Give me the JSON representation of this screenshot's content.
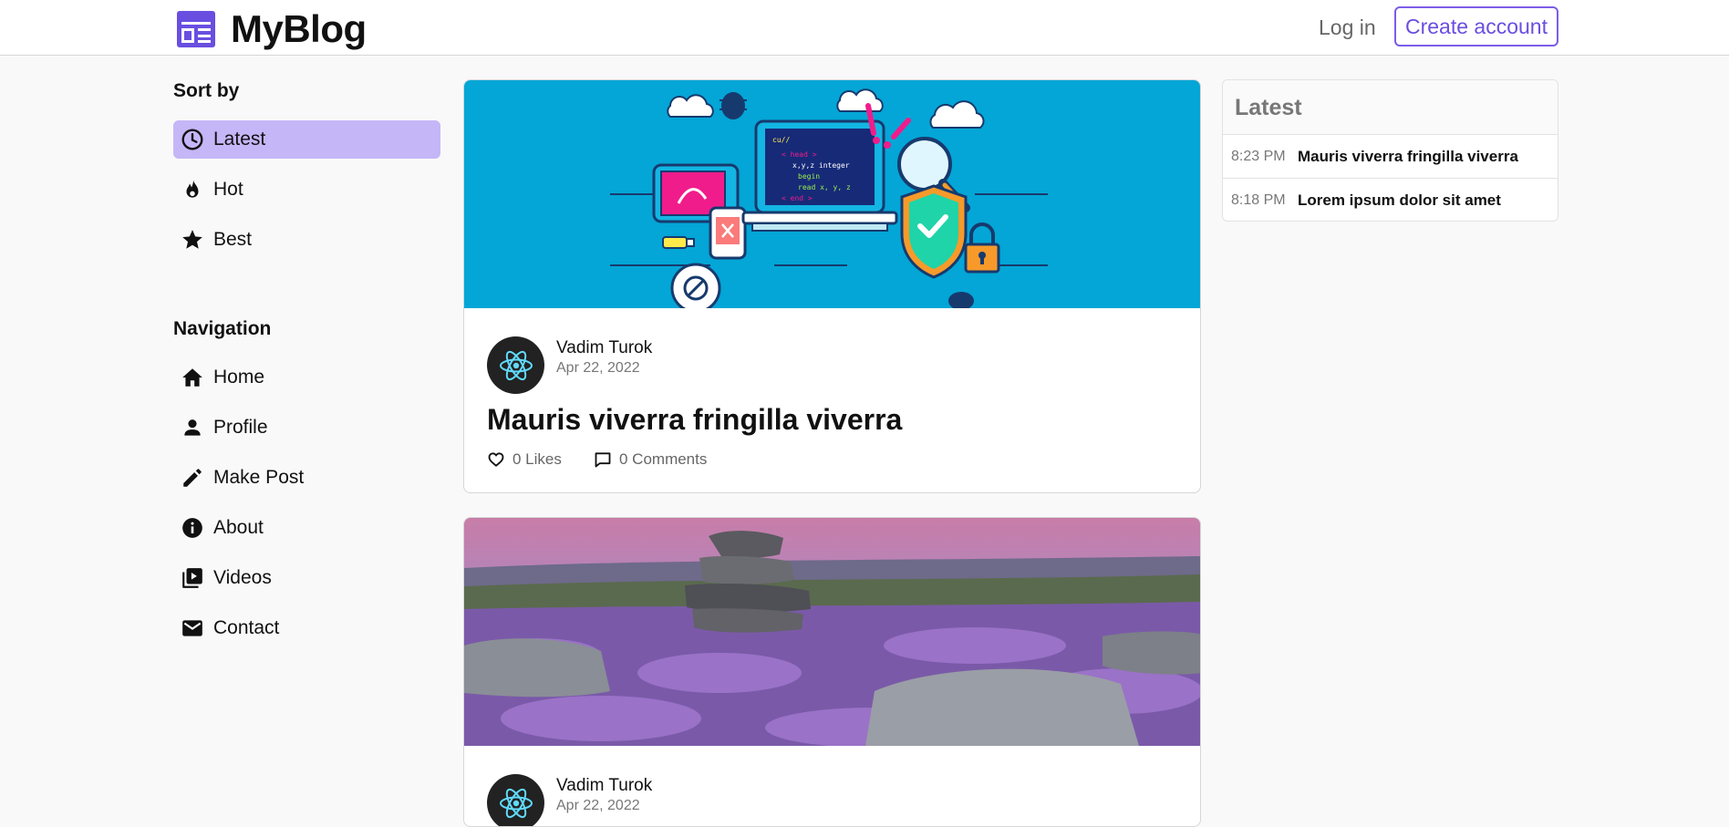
{
  "header": {
    "brand": "MyBlog",
    "login_label": "Log in",
    "create_label": "Create account"
  },
  "sidebar": {
    "sort_title": "Sort by",
    "sort_items": [
      {
        "label": "Latest",
        "icon": "clock-icon",
        "active": true
      },
      {
        "label": "Hot",
        "icon": "flame-icon"
      },
      {
        "label": "Best",
        "icon": "star-icon"
      }
    ],
    "nav_title": "Navigation",
    "nav_items": [
      {
        "label": "Home",
        "icon": "home-icon"
      },
      {
        "label": "Profile",
        "icon": "person-icon"
      },
      {
        "label": "Make Post",
        "icon": "pencil-icon"
      },
      {
        "label": "About",
        "icon": "info-icon"
      },
      {
        "label": "Videos",
        "icon": "video-library-icon"
      },
      {
        "label": "Contact",
        "icon": "mail-icon"
      }
    ]
  },
  "posts": [
    {
      "author": "Vadim Turok",
      "date": "Apr 22, 2022",
      "title": "Mauris viverra fringilla viverra",
      "likes": "0 Likes",
      "comments": "0 Comments",
      "cover_code": {
        "line1": "cu//",
        "line2": "< head >",
        "line3": "x,y,z integer",
        "line4": "begin",
        "line5": "read  x, y, z",
        "line6": "< end >"
      }
    },
    {
      "author": "Vadim Turok",
      "date": "Apr 22, 2022"
    }
  ],
  "latest": {
    "title": "Latest",
    "items": [
      {
        "time": "8:23 PM",
        "title": "Mauris viverra fringilla viverra"
      },
      {
        "time": "8:18 PM",
        "title": "Lorem ipsum dolor sit amet"
      }
    ]
  },
  "colors": {
    "accent": "#7c5ce8",
    "active_bg": "#c5b6f7",
    "cover1_bg": "#03a6d6"
  }
}
